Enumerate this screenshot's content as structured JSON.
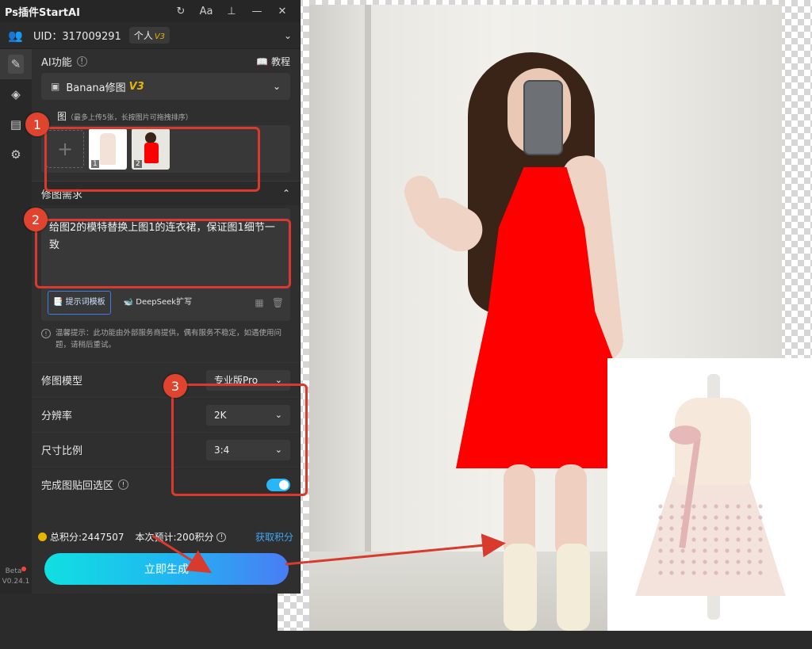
{
  "app": {
    "title": "Ps插件StartAI"
  },
  "titlebar": {
    "refresh_glyph": "↻",
    "font_glyph": "Aa",
    "pin_glyph": "📌",
    "minimize_glyph": "—",
    "close_glyph": "✕"
  },
  "user": {
    "uid_label": "UID：317009291",
    "plan": "个人",
    "plan_version": "V3"
  },
  "ai_function": {
    "label": "AI功能",
    "tutorial": "教程",
    "selected_tool": "Banana修图",
    "selected_version": "V3"
  },
  "upload": {
    "label": "图",
    "hint": "（最多上传5张，长按图片可拖拽排序）",
    "thumbs": [
      "1",
      "2"
    ]
  },
  "requirement": {
    "label": "修图需求",
    "text": "给图2的模特替换上图1的连衣裙，保证图1细节一致",
    "template_button": "提示词模板",
    "deepseek_button": "DeepSeek扩写"
  },
  "notice": {
    "text": "温馨提示：此功能由外部服务商提供，偶有服务不稳定，如遇使用问题，请稍后重试。"
  },
  "options": {
    "model_label": "修图模型",
    "model_value": "专业版Pro",
    "resolution_label": "分辨率",
    "resolution_value": "2K",
    "ratio_label": "尺寸比例",
    "ratio_value": "3:4",
    "paste_label": "完成图贴回选区",
    "paste_enabled": true
  },
  "points": {
    "total": "总积分:2447507",
    "estimate": "本次预计:200积分",
    "get": "获取积分"
  },
  "generate_button": "立即生成",
  "version": {
    "beta": "Beta",
    "number": "V0.24.1"
  },
  "annotations": [
    "1",
    "2",
    "3"
  ],
  "colors": {
    "accent": "#29b6f6",
    "gold": "#e8b400",
    "annotation_red": "#d83a2e",
    "dress_red": "#ff0000"
  }
}
